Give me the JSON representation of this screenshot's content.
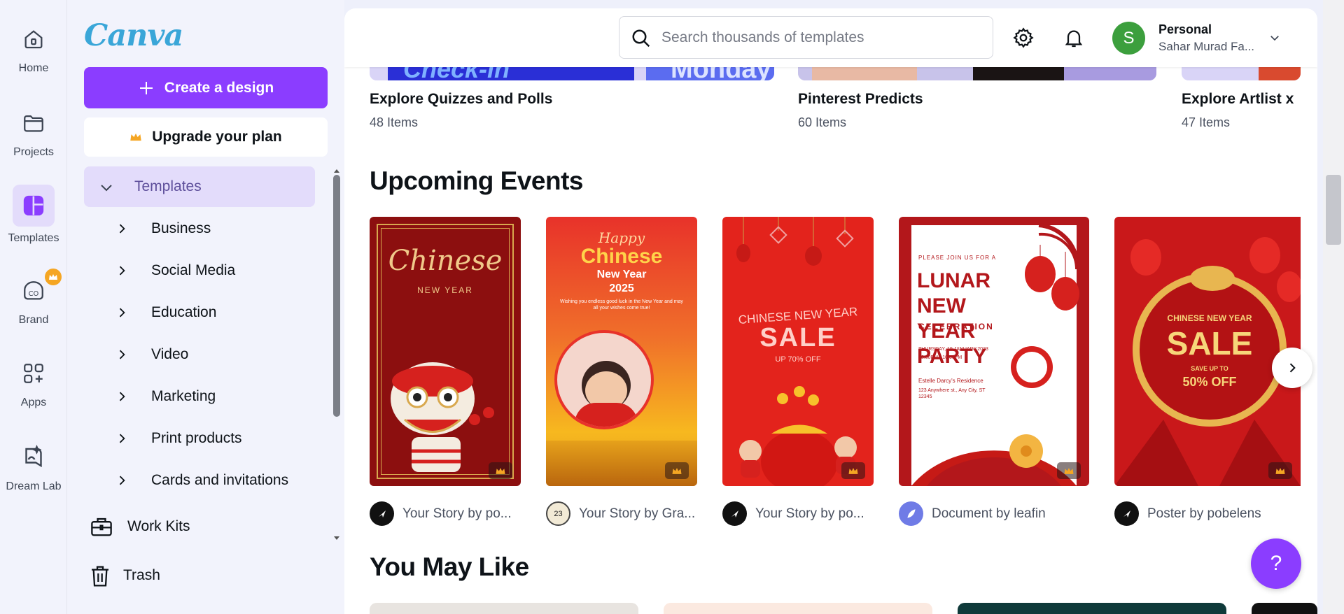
{
  "rail": {
    "items": [
      {
        "label": "Home",
        "icon": "home-icon"
      },
      {
        "label": "Projects",
        "icon": "folder-icon"
      },
      {
        "label": "Templates",
        "icon": "templates-icon"
      },
      {
        "label": "Brand",
        "icon": "brand-icon"
      },
      {
        "label": "Apps",
        "icon": "apps-icon"
      },
      {
        "label": "Dream Lab",
        "icon": "dream-lab-icon"
      }
    ]
  },
  "panel": {
    "logo": "Canva",
    "create_label": "Create a design",
    "upgrade_label": "Upgrade your plan",
    "templates_label": "Templates",
    "categories": [
      "Business",
      "Social Media",
      "Education",
      "Video",
      "Marketing",
      "Print products",
      "Cards and invitations"
    ],
    "work_kits_label": "Work Kits",
    "trash_label": "Trash"
  },
  "topbar": {
    "search_placeholder": "Search thousands of templates",
    "account_type": "Personal",
    "account_name": "Sahar Murad Fa..."
  },
  "avatar_letter": "S",
  "collections": [
    {
      "title": "Explore Quizzes and Polls",
      "count": "48 Items"
    },
    {
      "title": "Pinterest Predicts",
      "count": "60 Items"
    },
    {
      "title": "Explore Artlist x",
      "count": "47 Items"
    }
  ],
  "collection_thumb_text": {
    "check_in": "Check-in",
    "monday": "Monday"
  },
  "upcoming": {
    "title": "Upcoming Events",
    "cards": [
      {
        "author": "Your Story by po...",
        "heading": "Chinese",
        "sub": "NEW YEAR"
      },
      {
        "author": "Your Story by Gra...",
        "heading": "Chinese",
        "top": "Happy",
        "sub": "New Year",
        "year": "2025",
        "badge": "23",
        "blurb": "Wishing you endless good luck in the New Year and may all your wishes come true!"
      },
      {
        "author": "Your Story by po...",
        "heading": "SALE",
        "top": "CHINESE NEW YEAR",
        "sub": "UP 70% OFF"
      },
      {
        "author": "Document by leafin",
        "top": "PLEASE JOIN US FOR A",
        "heading": "LUNAR NEW YEAR PARTY",
        "sub": "CELEBRATION",
        "date": "THURSDAY, 19 JANUARY,2023",
        "time": "08:00PM - 10:00PM",
        "host": "Estelle Darcy's Residence",
        "address": "123 Anywhere st., Any City, ST 12345"
      },
      {
        "author": "Poster by pobelens",
        "top": "CHINESE NEW YEAR",
        "heading": "SALE",
        "sub": "SAVE UP TO",
        "discount": "50% OFF"
      }
    ]
  },
  "you_may_like": {
    "title": "You May Like"
  },
  "help_label": "?",
  "colors": {
    "brand_purple": "#8b3dff",
    "accent_red": "#d6211e",
    "active_bg": "#e3dcfb"
  }
}
